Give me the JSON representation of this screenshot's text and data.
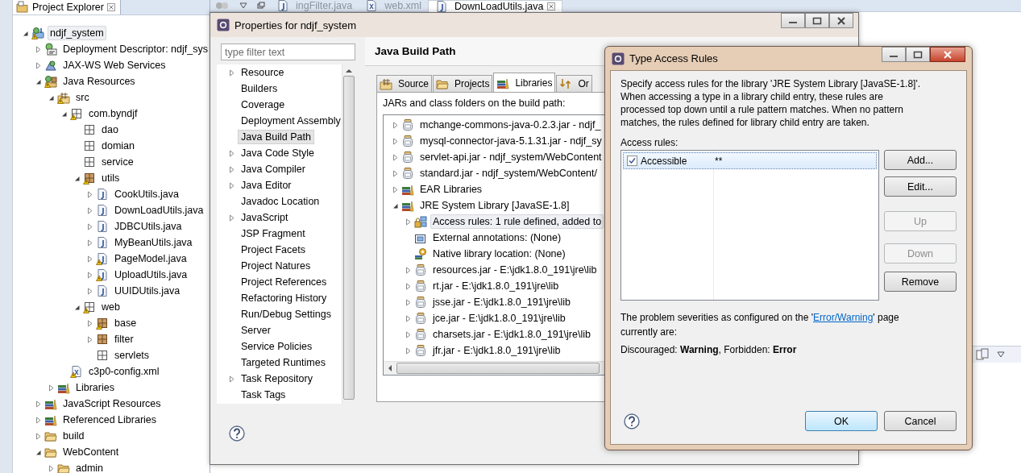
{
  "project_explorer": {
    "title": "Project Explorer",
    "tree": [
      {
        "label": "ndjf_system",
        "kind": "project",
        "warning": true,
        "expanded": true,
        "selected": true,
        "children": [
          {
            "label": "Deployment Descriptor: ndjf_sys",
            "kind": "descriptor",
            "warning": false,
            "expanded": false,
            "selected": false
          },
          {
            "label": "JAX-WS Web Services",
            "kind": "webservices",
            "warning": false,
            "expanded": false,
            "selected": false
          },
          {
            "label": "Java Resources",
            "kind": "resources",
            "warning": true,
            "expanded": true,
            "selected": false,
            "children": [
              {
                "label": "src",
                "kind": "source",
                "warning": true,
                "expanded": true,
                "selected": false,
                "children": [
                  {
                    "label": "com.byndjf",
                    "kind": "package",
                    "warning": true,
                    "expanded": true,
                    "selected": false,
                    "children": [
                      {
                        "label": "dao",
                        "kind": "package",
                        "warning": false,
                        "selected": false
                      },
                      {
                        "label": "domian",
                        "kind": "package",
                        "warning": false,
                        "selected": false
                      },
                      {
                        "label": "service",
                        "kind": "package",
                        "warning": false,
                        "selected": false
                      },
                      {
                        "label": "utils",
                        "kind": "filled",
                        "warning": true,
                        "expanded": true,
                        "selected": false,
                        "children": [
                          {
                            "label": "CookUtils.java",
                            "kind": "java",
                            "warning": false,
                            "expanded": false,
                            "selected": false
                          },
                          {
                            "label": "DownLoadUtils.java",
                            "kind": "java",
                            "warning": false,
                            "expanded": false,
                            "selected": false
                          },
                          {
                            "label": "JDBCUtils.java",
                            "kind": "java",
                            "warning": false,
                            "expanded": false,
                            "selected": false
                          },
                          {
                            "label": "MyBeanUtils.java",
                            "kind": "java",
                            "warning": false,
                            "expanded": false,
                            "selected": false
                          },
                          {
                            "label": "PageModel.java",
                            "kind": "java",
                            "warning": true,
                            "expanded": false,
                            "selected": false
                          },
                          {
                            "label": "UploadUtils.java",
                            "kind": "java",
                            "warning": true,
                            "expanded": false,
                            "selected": false
                          },
                          {
                            "label": "UUIDUtils.java",
                            "kind": "java",
                            "warning": false,
                            "expanded": false,
                            "selected": false
                          }
                        ]
                      },
                      {
                        "label": "web",
                        "kind": "package",
                        "warning": true,
                        "expanded": true,
                        "selected": false,
                        "children": [
                          {
                            "label": "base",
                            "kind": "filled",
                            "warning": true,
                            "expanded": false,
                            "selected": false
                          },
                          {
                            "label": "filter",
                            "kind": "filled",
                            "warning": false,
                            "expanded": false,
                            "selected": false
                          },
                          {
                            "label": "servlets",
                            "kind": "package",
                            "warning": false,
                            "selected": false
                          }
                        ]
                      }
                    ]
                  },
                  {
                    "label": "c3p0-config.xml",
                    "kind": "xml",
                    "warning": true,
                    "selected": false
                  }
                ]
              },
              {
                "label": "Libraries",
                "kind": "library",
                "warning": false,
                "expanded": false,
                "selected": false
              }
            ]
          },
          {
            "label": "JavaScript Resources",
            "kind": "library",
            "warning": false,
            "expanded": false,
            "selected": false
          },
          {
            "label": "Referenced Libraries",
            "kind": "library",
            "warning": false,
            "expanded": false,
            "selected": false
          },
          {
            "label": "build",
            "kind": "folder",
            "warning": false,
            "expanded": false,
            "selected": false
          },
          {
            "label": "WebContent",
            "kind": "folder",
            "warning": false,
            "expanded": true,
            "selected": false,
            "children": [
              {
                "label": "admin",
                "kind": "folder",
                "warning": false,
                "expanded": false,
                "selected": false
              }
            ]
          }
        ]
      }
    ]
  },
  "editor_tabs": [
    {
      "label": "ingFilter.java",
      "kind": "java",
      "selected": false
    },
    {
      "label": "web.xml",
      "kind": "xml",
      "selected": false
    },
    {
      "label": "DownLoadUtils.java",
      "kind": "java",
      "selected": true
    }
  ],
  "properties_dialog": {
    "title": "Properties for ndjf_system",
    "filter": {
      "placeholder": "type filter text"
    },
    "nav": [
      {
        "label": "Resource",
        "expanded": false,
        "selected": false
      },
      {
        "label": "Builders",
        "selected": false
      },
      {
        "label": "Coverage",
        "selected": false
      },
      {
        "label": "Deployment Assembly",
        "selected": false
      },
      {
        "label": "Java Build Path",
        "selected": true
      },
      {
        "label": "Java Code Style",
        "expanded": false,
        "selected": false
      },
      {
        "label": "Java Compiler",
        "expanded": false,
        "selected": false
      },
      {
        "label": "Java Editor",
        "expanded": false,
        "selected": false
      },
      {
        "label": "Javadoc Location",
        "selected": false
      },
      {
        "label": "JavaScript",
        "expanded": false,
        "selected": false
      },
      {
        "label": "JSP Fragment",
        "selected": false
      },
      {
        "label": "Project Facets",
        "selected": false
      },
      {
        "label": "Project Natures",
        "selected": false
      },
      {
        "label": "Project References",
        "selected": false
      },
      {
        "label": "Refactoring History",
        "selected": false
      },
      {
        "label": "Run/Debug Settings",
        "selected": false
      },
      {
        "label": "Server",
        "selected": false
      },
      {
        "label": "Service Policies",
        "selected": false
      },
      {
        "label": "Targeted Runtimes",
        "selected": false
      },
      {
        "label": "Task Repository",
        "expanded": false,
        "selected": false
      },
      {
        "label": "Task Tags",
        "selected": false
      }
    ],
    "page_title": "Java Build Path",
    "tabs": [
      {
        "label": "Source",
        "kind": "source",
        "selected": false
      },
      {
        "label": "Projects",
        "kind": "folder",
        "selected": false
      },
      {
        "label": "Libraries",
        "kind": "library",
        "selected": true
      },
      {
        "label": "Or",
        "kind": "order",
        "selected": false
      }
    ],
    "list_label": "JARs and class folders on the build path:",
    "entries": [
      {
        "label": "mchange-commons-java-0.2.3.jar - ndjf_",
        "kind": "jar",
        "expanded": false,
        "selected": false
      },
      {
        "label": "mysql-connector-java-5.1.31.jar - ndjf_sy",
        "kind": "jar",
        "expanded": false,
        "selected": false
      },
      {
        "label": "servlet-api.jar - ndjf_system/WebContent",
        "kind": "jar",
        "expanded": false,
        "selected": false
      },
      {
        "label": "standard.jar - ndjf_system/WebContent/",
        "kind": "jar",
        "expanded": false,
        "selected": false
      },
      {
        "label": "EAR Libraries",
        "kind": "library",
        "expanded": false,
        "selected": false
      },
      {
        "label": "JRE System Library [JavaSE-1.8]",
        "kind": "library",
        "expanded": true,
        "selected": false,
        "children": [
          {
            "label": "Access rules: 1 rule defined, added to",
            "kind": "access",
            "expanded": false,
            "selected": true
          },
          {
            "label": "External annotations: (None)",
            "kind": "annotation",
            "selected": false
          },
          {
            "label": "Native library location: (None)",
            "kind": "native",
            "selected": false
          },
          {
            "label": "resources.jar - E:\\jdk1.8.0_191\\jre\\lib",
            "kind": "jar",
            "expanded": false,
            "selected": false
          },
          {
            "label": "rt.jar - E:\\jdk1.8.0_191\\jre\\lib",
            "kind": "jar",
            "expanded": false,
            "selected": false
          },
          {
            "label": "jsse.jar - E:\\jdk1.8.0_191\\jre\\lib",
            "kind": "jar",
            "expanded": false,
            "selected": false
          },
          {
            "label": "jce.jar - E:\\jdk1.8.0_191\\jre\\lib",
            "kind": "jar",
            "expanded": false,
            "selected": false
          },
          {
            "label": "charsets.jar - E:\\jdk1.8.0_191\\jre\\lib",
            "kind": "jar",
            "expanded": false,
            "selected": false
          },
          {
            "label": "jfr.jar - E:\\jdk1.8.0_191\\jre\\lib",
            "kind": "jar",
            "expanded": false,
            "selected": false
          }
        ]
      }
    ]
  },
  "access_rules_dialog": {
    "title": "Type Access Rules",
    "description": "Specify access rules for the library 'JRE System Library [JavaSE-1.8]'. When accessing a type in a library child entry, these rules are processed top down until a rule pattern matches. When no pattern matches, the rules defined for library child entry are taken.",
    "rules_label": "Access rules:",
    "rules": [
      {
        "checked": true,
        "resolution": "Accessible",
        "pattern": "**",
        "selected": true
      }
    ],
    "buttons": [
      {
        "label": "Add...",
        "disabled": false
      },
      {
        "label": "Edit...",
        "disabled": false
      },
      {
        "label": "Up",
        "disabled": true
      },
      {
        "label": "Down",
        "disabled": true
      },
      {
        "label": "Remove",
        "disabled": false
      }
    ],
    "note": {
      "before": "The problem severities as configured on the '",
      "link": "Error/Warning",
      "after": "' page currently are:"
    },
    "severities": "Discouraged: **Warning**, Forbidden: **Error**",
    "actions": [
      {
        "label": "OK",
        "default": true
      },
      {
        "label": "Cancel",
        "default": false
      }
    ]
  }
}
